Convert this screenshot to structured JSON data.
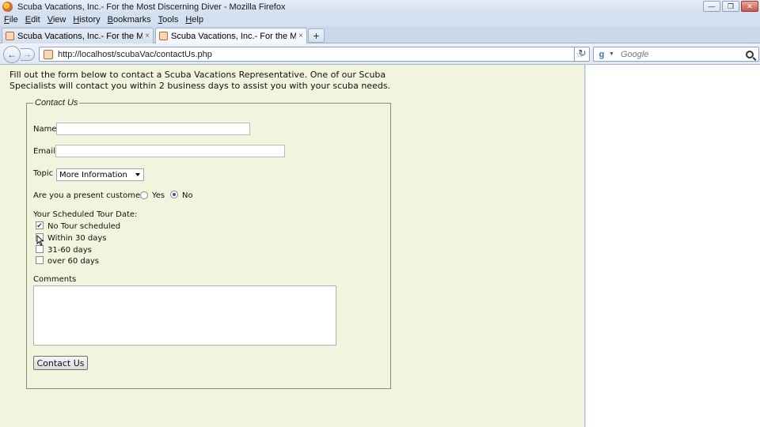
{
  "window": {
    "title": "Scuba Vacations, Inc.- For the Most Discerning Diver - Mozilla Firefox",
    "minimize": "—",
    "maximize": "❐",
    "close": "✕"
  },
  "menu": [
    "File",
    "Edit",
    "View",
    "History",
    "Bookmarks",
    "Tools",
    "Help"
  ],
  "tabs": [
    {
      "label": "Scuba Vacations, Inc.- For the Most D...",
      "active": false
    },
    {
      "label": "Scuba Vacations, Inc.- For the Most D...",
      "active": true
    }
  ],
  "tab_close": "×",
  "new_tab": "+",
  "nav": {
    "back": "←",
    "forward": "→",
    "url": "http://localhost/scubaVac/contactUs.php",
    "star": "☆",
    "reload": "↻"
  },
  "search": {
    "engine_icon": "g",
    "dropdown": "▼",
    "placeholder": "Google"
  },
  "page": {
    "intro": "Fill out the form below to contact a Scuba Vacations Representative. One of our Scuba Specialists will contact you within 2 business days to assist you with your scuba needs.",
    "legend": "Contact Us",
    "name_label": "Name",
    "name_value": "",
    "email_label": "Email",
    "email_value": "",
    "topic_label": "Topic",
    "topic_selected": "More Information",
    "customer_label": "Are you a present customer?",
    "yes_label": "Yes",
    "no_label": "No",
    "customer_value": "No",
    "tour_label": "Your Scheduled Tour Date:",
    "tour_options": [
      {
        "label": "No Tour scheduled",
        "checked": true
      },
      {
        "label": "Within 30 days",
        "checked": false
      },
      {
        "label": "31-60 days",
        "checked": false
      },
      {
        "label": "over 60 days",
        "checked": false
      }
    ],
    "checkmark": "✔",
    "comments_label": "Comments",
    "comments_value": "",
    "submit_label": "Contact Us"
  },
  "colors": {
    "page_bg": "#f3f4dd",
    "chrome_bg": "#d3e0f0",
    "radio_dot": "#2a5aa8"
  }
}
